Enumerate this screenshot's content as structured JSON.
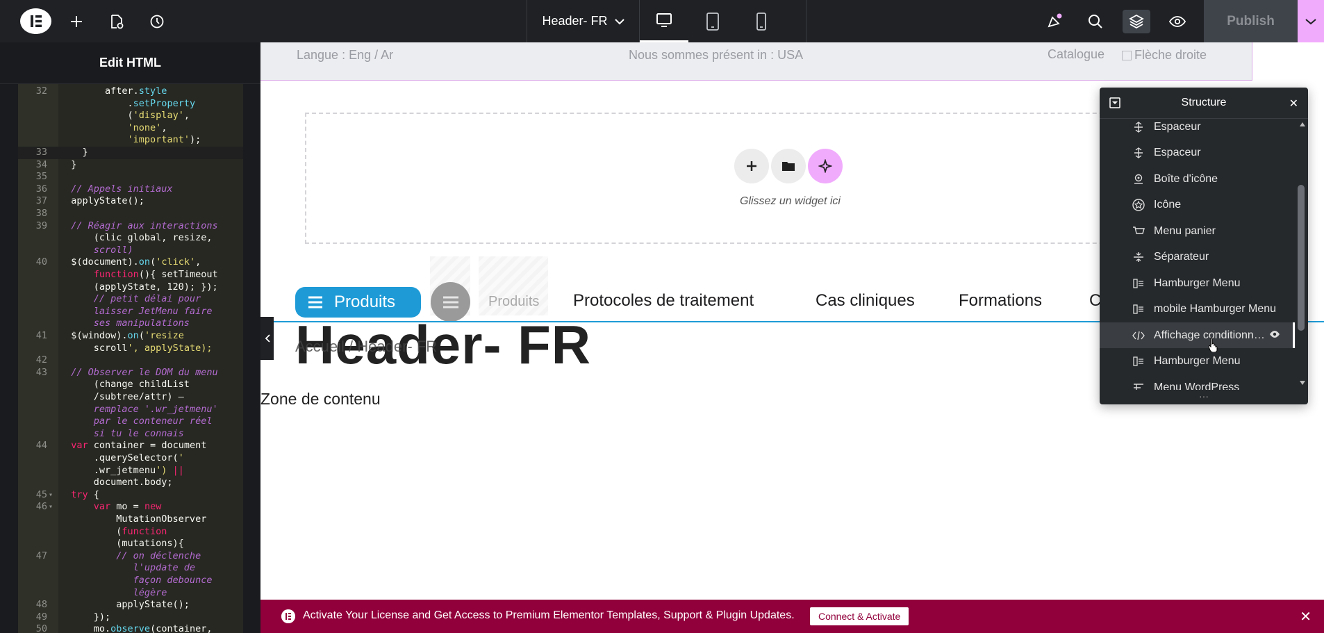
{
  "topbar": {
    "document_title": "Header- FR",
    "publish_label": "Publish",
    "icons": [
      "elementor-logo-icon",
      "add-icon",
      "page-settings-icon",
      "history-icon",
      "desktop-icon",
      "tablet-icon",
      "mobile-icon",
      "notifications-icon",
      "search-icon",
      "structure-icon",
      "preview-icon",
      "chevron-down-icon"
    ],
    "colors": {
      "bar": "#1f2124",
      "accent": "#f0abfc",
      "publish_disabled": "#3f444b"
    }
  },
  "left_panel": {
    "title": "Edit HTML"
  },
  "canvas": {
    "top_strip": {
      "language": "Langue : Eng / Ar",
      "presence": "Nous sommes présent in : USA",
      "catalogue": "Catalogue",
      "arrow_alt": "Flèche droite"
    },
    "dropzone_text": "Glissez un widget ici",
    "menu": {
      "produits_label": "Produits",
      "items": [
        "Produits",
        "Protocoles de traitement",
        "Cas cliniques",
        "Formations",
        "C"
      ]
    },
    "page_title": "Header- FR",
    "breadcrumb": "Accueil / Header- FR",
    "content_zone": "Zone de contenu",
    "colors": {
      "primary_blue": "#1e9bd7",
      "strip_border": "#d9a6e7"
    }
  },
  "structure_panel": {
    "title": "Structure",
    "items": [
      {
        "label": "Espaceur",
        "icon": "spacer-icon"
      },
      {
        "label": "Espaceur",
        "icon": "spacer-icon"
      },
      {
        "label": "Boîte d'icône",
        "icon": "icon-box-icon"
      },
      {
        "label": "Icône",
        "icon": "star-icon"
      },
      {
        "label": "Menu panier",
        "icon": "cart-icon"
      },
      {
        "label": "Séparateur",
        "icon": "divider-icon"
      },
      {
        "label": "Hamburger Menu",
        "icon": "hamburger-widget-icon"
      },
      {
        "label": "mobile Hamburger Menu",
        "icon": "hamburger-widget-icon"
      },
      {
        "label": "Affichage conditionn…",
        "icon": "code-icon"
      },
      {
        "label": "Hamburger Menu",
        "icon": "hamburger-widget-icon"
      },
      {
        "label": "Menu WordPress",
        "icon": "wp-menu-icon"
      }
    ],
    "footer": "···"
  },
  "banner": {
    "text": "Activate Your License and Get Access to Premium Elementor Templates, Support & Plugin Updates.",
    "button_label": "Connect & Activate",
    "color": "#92003b"
  },
  "code_editor": {
    "lines": [
      {
        "n": "32",
        "t": "        after.style"
      },
      {
        "n": "",
        "t": "            .setProperty"
      },
      {
        "n": "",
        "t": "            ('display',"
      },
      {
        "n": "",
        "t": "            'none',"
      },
      {
        "n": "",
        "t": "            'important');"
      },
      {
        "n": "33",
        "t": "    }"
      },
      {
        "n": "34",
        "t": "  }"
      },
      {
        "n": "35",
        "t": ""
      },
      {
        "n": "36",
        "t": "  // Appels initiaux"
      },
      {
        "n": "37",
        "t": "  applyState();"
      },
      {
        "n": "38",
        "t": ""
      },
      {
        "n": "39",
        "t": "  // Réagir aux interactions"
      },
      {
        "n": "",
        "t": "      (clic global, resize,"
      },
      {
        "n": "",
        "t": "      scroll)"
      },
      {
        "n": "40",
        "t": "  $(document).on('click',"
      },
      {
        "n": "",
        "t": "      function(){ setTimeout"
      },
      {
        "n": "",
        "t": "      (applyState, 120); });"
      },
      {
        "n": "",
        "t": "      // petit délai pour"
      },
      {
        "n": "",
        "t": "      laisser JetMenu faire"
      },
      {
        "n": "",
        "t": "      ses manipulations"
      },
      {
        "n": "41",
        "t": "  $(window).on('resize"
      },
      {
        "n": "",
        "t": "      scroll', applyState);"
      },
      {
        "n": "42",
        "t": ""
      },
      {
        "n": "43",
        "t": "  // Observer le DOM du menu"
      },
      {
        "n": "",
        "t": "      (change childList"
      },
      {
        "n": "",
        "t": "      /subtree/attr) —"
      },
      {
        "n": "",
        "t": "      remplace '.wr_jetmenu'"
      },
      {
        "n": "",
        "t": "      par le conteneur réel"
      },
      {
        "n": "",
        "t": "      si tu le connais"
      },
      {
        "n": "44",
        "t": "  var container = document"
      },
      {
        "n": "",
        "t": "      .querySelector('"
      },
      {
        "n": "",
        "t": "      .wr_jetmenu') ||"
      },
      {
        "n": "",
        "t": "      document.body;"
      },
      {
        "n": "45",
        "t": "  try {"
      },
      {
        "n": "46",
        "t": "      var mo = new"
      },
      {
        "n": "",
        "t": "          MutationObserver"
      },
      {
        "n": "",
        "t": "          (function"
      },
      {
        "n": "",
        "t": "          (mutations){"
      },
      {
        "n": "47",
        "t": "          // on déclenche"
      },
      {
        "n": "",
        "t": "             l'update de"
      },
      {
        "n": "",
        "t": "             façon debounce"
      },
      {
        "n": "",
        "t": "             légère"
      },
      {
        "n": "48",
        "t": "          applyState();"
      },
      {
        "n": "49",
        "t": "      });"
      },
      {
        "n": "50",
        "t": "      mo.observe(container,"
      }
    ]
  }
}
